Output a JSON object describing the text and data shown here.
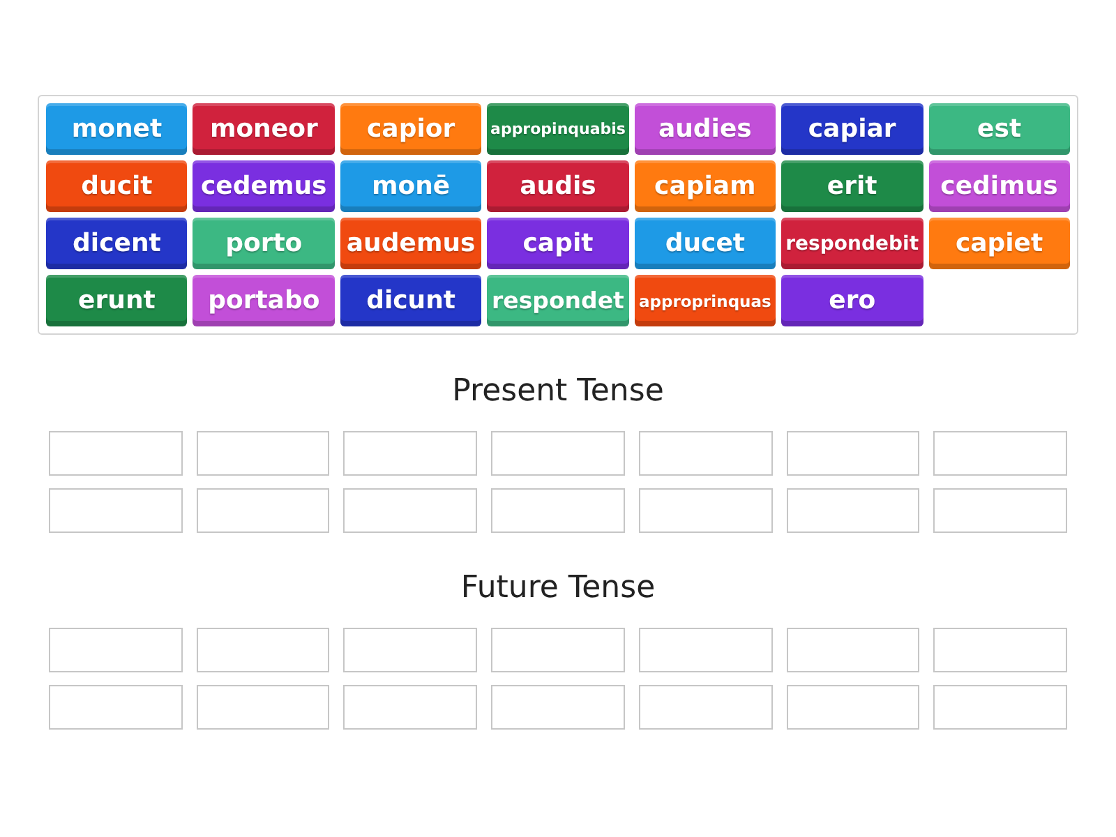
{
  "tiles": [
    {
      "label": "monet",
      "color": "#1e9ae6"
    },
    {
      "label": "moneor",
      "color": "#d0223d"
    },
    {
      "label": "capior",
      "color": "#ff7a10"
    },
    {
      "label": "appropinquabis",
      "color": "#1e8a48"
    },
    {
      "label": "audies",
      "color": "#c24fd8"
    },
    {
      "label": "capiar",
      "color": "#2436c8"
    },
    {
      "label": "est",
      "color": "#3cb883"
    },
    {
      "label": "ducit",
      "color": "#f04a10"
    },
    {
      "label": "cedemus",
      "color": "#7a2fe0"
    },
    {
      "label": "monē",
      "color": "#1e9ae6"
    },
    {
      "label": "audis",
      "color": "#d0223d"
    },
    {
      "label": "capiam",
      "color": "#ff7a10"
    },
    {
      "label": "erit",
      "color": "#1e8a48"
    },
    {
      "label": "cedimus",
      "color": "#c24fd8"
    },
    {
      "label": "dicent",
      "color": "#2436c8"
    },
    {
      "label": "porto",
      "color": "#3cb883"
    },
    {
      "label": "audemus",
      "color": "#f04a10"
    },
    {
      "label": "capit",
      "color": "#7a2fe0"
    },
    {
      "label": "ducet",
      "color": "#1e9ae6"
    },
    {
      "label": "respondebit",
      "color": "#d0223d"
    },
    {
      "label": "capiet",
      "color": "#ff7a10"
    },
    {
      "label": "erunt",
      "color": "#1e8a48"
    },
    {
      "label": "portabo",
      "color": "#c24fd8"
    },
    {
      "label": "dicunt",
      "color": "#2436c8"
    },
    {
      "label": "respondet",
      "color": "#3cb883"
    },
    {
      "label": "approprinquas",
      "color": "#f04a10"
    },
    {
      "label": "ero",
      "color": "#7a2fe0"
    }
  ],
  "groups": [
    {
      "title": "Present Tense",
      "slots": [
        {
          "kind": "blank"
        },
        {
          "kind": "blank"
        },
        {
          "kind": "blank"
        },
        {
          "kind": "blank"
        },
        {
          "kind": "blank"
        },
        {
          "kind": "blank"
        },
        {
          "kind": "blank"
        },
        {
          "kind": "blank"
        },
        {
          "kind": "blank"
        },
        {
          "kind": "blank"
        },
        {
          "kind": "blank"
        },
        {
          "kind": "blank"
        },
        {
          "kind": "blank"
        },
        {
          "kind": "blank"
        }
      ]
    },
    {
      "title": "Future Tense",
      "slots": [
        {
          "kind": "blank"
        },
        {
          "kind": "blank"
        },
        {
          "kind": "blank"
        },
        {
          "kind": "blank"
        },
        {
          "kind": "blank"
        },
        {
          "kind": "blank"
        },
        {
          "kind": "blank"
        },
        {
          "kind": "blank"
        },
        {
          "kind": "blank"
        },
        {
          "kind": "blank"
        },
        {
          "kind": "blank"
        },
        {
          "kind": "blank"
        },
        {
          "kind": "blank"
        },
        {
          "kind": "blank"
        }
      ]
    }
  ]
}
